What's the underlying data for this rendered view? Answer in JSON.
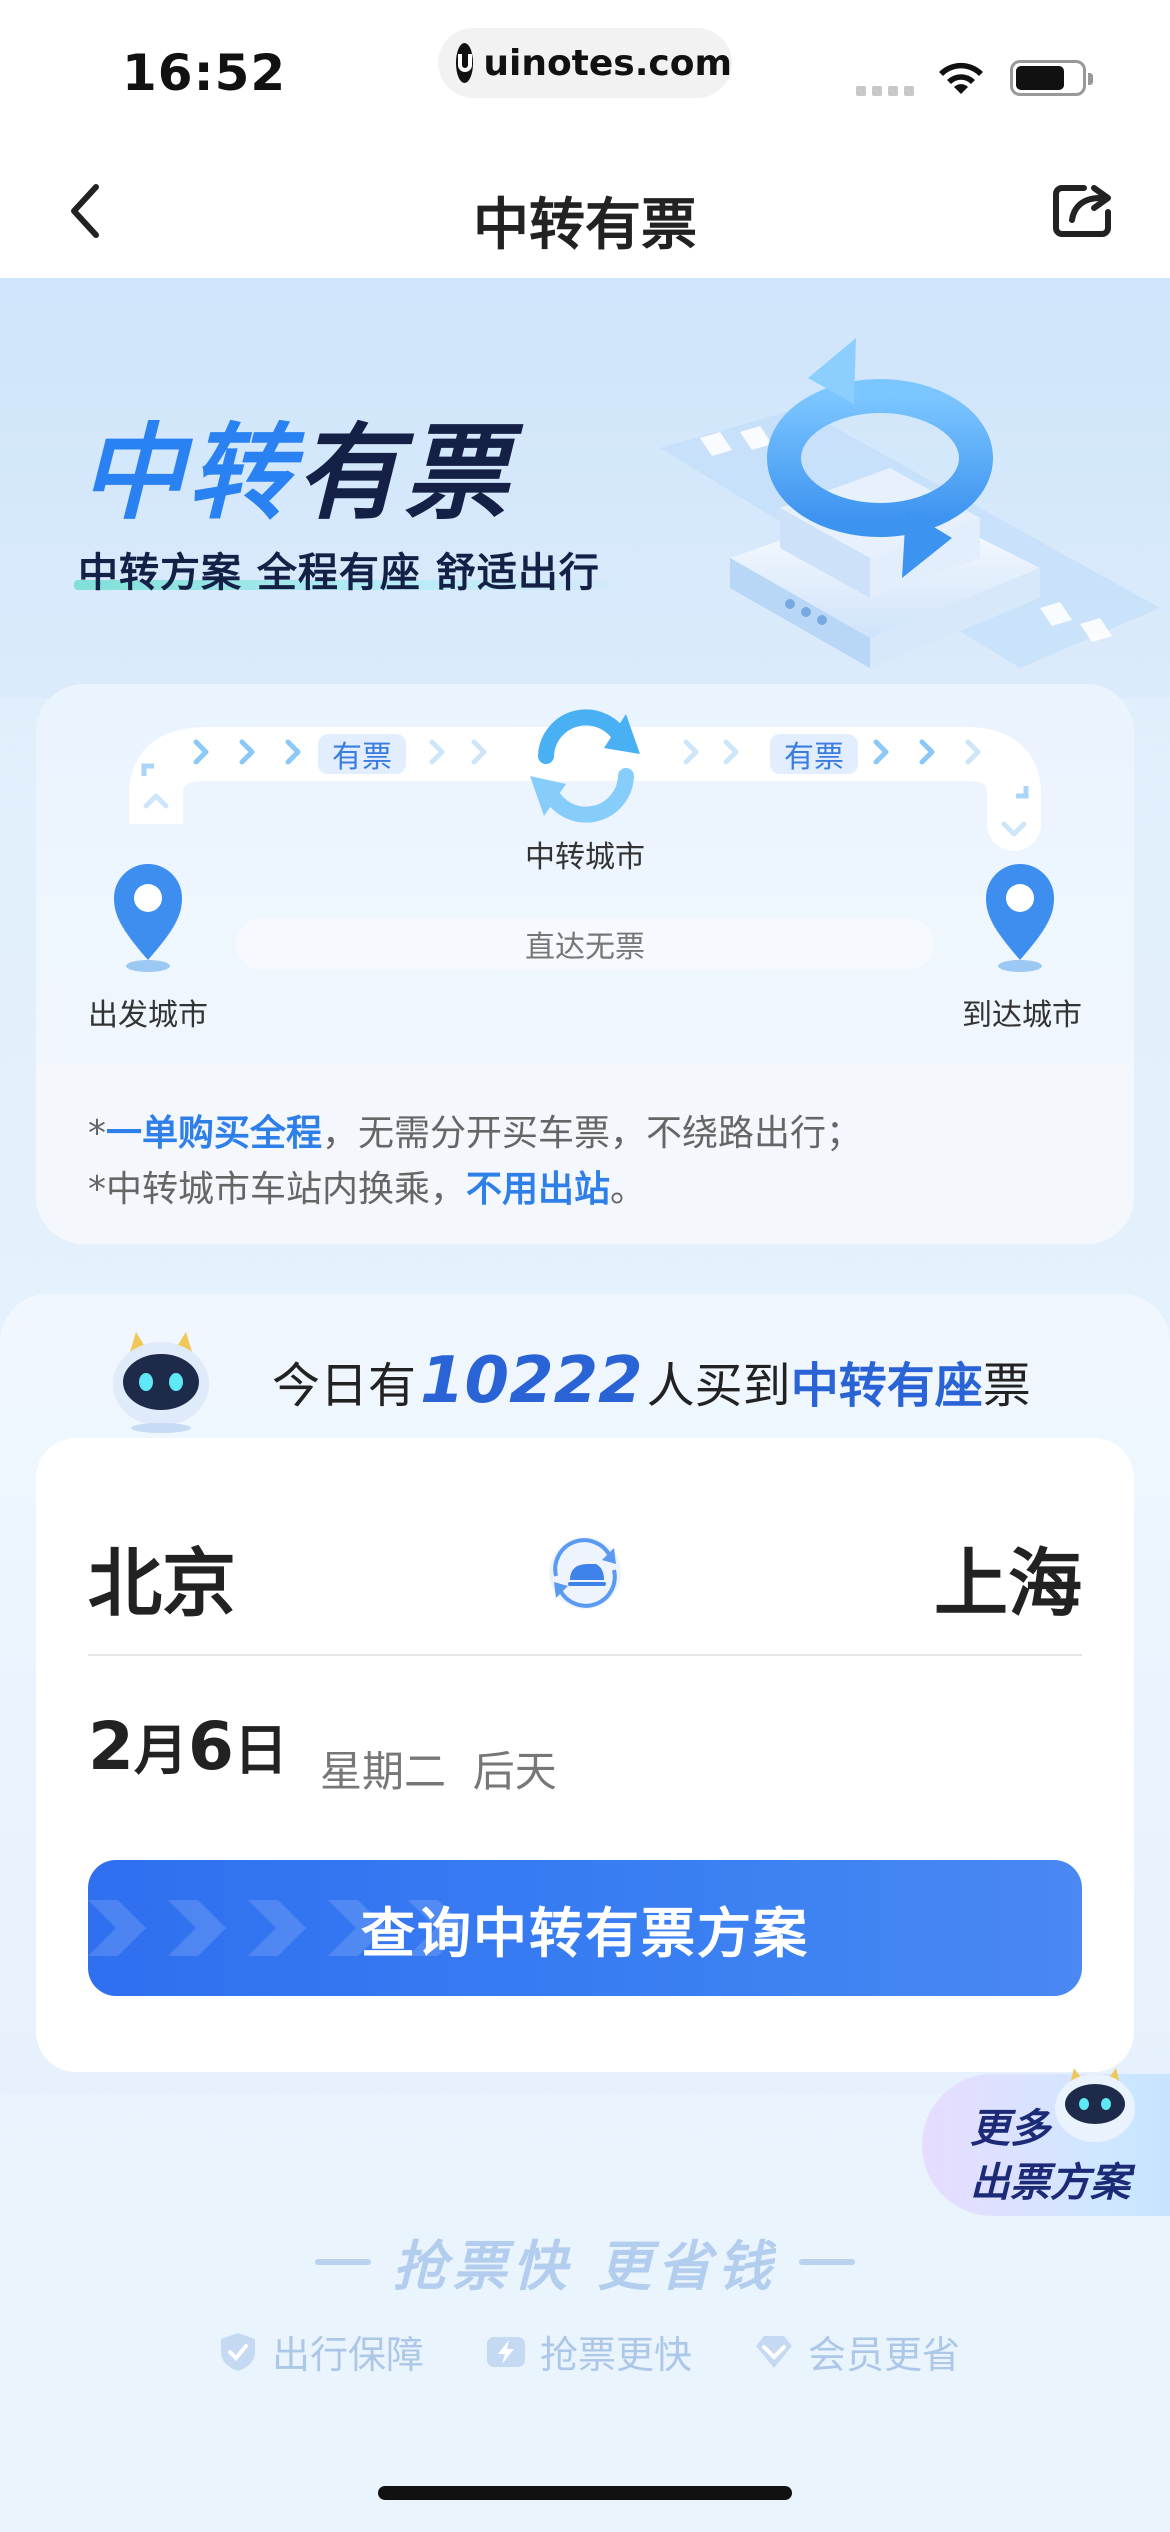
{
  "status_bar": {
    "time": "16:52",
    "url": "uinotes.com"
  },
  "navbar": {
    "title": "中转有票",
    "back_icon": "chevron-left-icon",
    "share_icon": "share-icon"
  },
  "hero": {
    "title_blue": "中转",
    "title_dark": "有票",
    "subtitle": "中转方案 全程有座 舒适出行"
  },
  "route": {
    "tag_left": "有票",
    "tag_right": "有票",
    "transfer_city": "中转城市",
    "direct_label": "直达无票",
    "departure_label": "出发城市",
    "arrival_label": "到达城市",
    "note1_prefix": "*",
    "note1_highlight": "一单购买全程",
    "note1_rest": "，无需分开买车票，不绕路出行；",
    "note2_prefix": "*中转城市车站内换乘，",
    "note2_highlight": "不用出站",
    "note2_suffix": "。"
  },
  "stats": {
    "prefix": "今日有",
    "count": "10222",
    "middle": "人买到",
    "highlight": "中转有座",
    "suffix": "票"
  },
  "booking": {
    "from_city": "北京",
    "to_city": "上海",
    "date_month": "2",
    "month_unit": "月",
    "date_day": "6",
    "day_unit": "日",
    "weekday": "星期二",
    "relative_day": "后天",
    "search_button": "查询中转有票方案"
  },
  "float_button": {
    "line1": "更多",
    "line2": "出票方案"
  },
  "slogan": "抢票快 更省钱",
  "features": [
    {
      "icon": "shield-check-icon",
      "label": "出行保障"
    },
    {
      "icon": "lightning-icon",
      "label": "抢票更快"
    },
    {
      "icon": "diamond-icon",
      "label": "会员更省"
    }
  ],
  "colors": {
    "accent": "#2f6ff0",
    "highlight_text": "#2a63d6",
    "title_dark": "#152046"
  }
}
